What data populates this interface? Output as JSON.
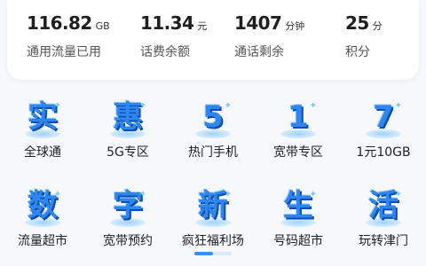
{
  "stats": [
    {
      "value": "116.82",
      "unit": "GB",
      "label": "通用流量已用"
    },
    {
      "value": "11.34",
      "unit": "元",
      "label": "话费余额"
    },
    {
      "value": "1407",
      "unit": "分钟",
      "label": "通话剩余"
    },
    {
      "value": "25",
      "unit": "分",
      "label": "积分"
    }
  ],
  "grid": {
    "items": [
      {
        "glyph": "实",
        "label": "全球通",
        "icon": "shi-character-icon"
      },
      {
        "glyph": "惠",
        "label": "5G专区",
        "icon": "hui-character-icon"
      },
      {
        "glyph": "5",
        "label": "热门手机",
        "icon": "number-5-icon"
      },
      {
        "glyph": "1",
        "label": "宽带专区",
        "icon": "number-1-icon"
      },
      {
        "glyph": "7",
        "label": "1元10GB",
        "icon": "number-7-icon"
      },
      {
        "glyph": "数",
        "label": "流量超市",
        "icon": "shu-character-icon"
      },
      {
        "glyph": "字",
        "label": "宽带预约",
        "icon": "zi-character-icon"
      },
      {
        "glyph": "新",
        "label": "疯狂福利场",
        "icon": "xin-character-icon"
      },
      {
        "glyph": "生",
        "label": "号码超市",
        "icon": "sheng-character-icon"
      },
      {
        "glyph": "活",
        "label": "玩转津门",
        "icon": "huo-character-icon"
      }
    ]
  },
  "pager": {
    "pages": 2,
    "current": 1
  },
  "colors": {
    "accent": "#3f8cf7",
    "icon_blue": "#2f86f0",
    "icon_shadow": "#0d4eb0"
  }
}
